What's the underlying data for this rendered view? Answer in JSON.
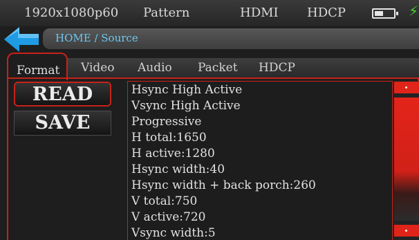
{
  "status_bar": {
    "resolution": "1920x1080p60",
    "mode": "Pattern",
    "interface": "HDMI",
    "protection": "HDCP",
    "battery_icon": "battery-icon",
    "charging_icon": "bolt-icon"
  },
  "breadcrumb": "HOME / Source",
  "tabs": [
    {
      "label": "Format",
      "active": true
    },
    {
      "label": "Video",
      "active": false
    },
    {
      "label": "Audio",
      "active": false
    },
    {
      "label": "Packet",
      "active": false
    },
    {
      "label": "HDCP",
      "active": false
    }
  ],
  "actions": {
    "read_label": "READ",
    "save_label": "SAVE"
  },
  "format_info": [
    "Hsync High Active",
    "Vsync High Active",
    "Progressive",
    "H total:1650",
    "H active:1280",
    "Hsync width:40",
    "Hsync width + back porch:260",
    "V total:750",
    "V active:720",
    "Vsync width:5"
  ],
  "colors": {
    "accent_red": "#c8221a",
    "breadcrumb_blue": "#6ec7f2",
    "back_arrow_blue": "#1e9be3",
    "charging_green": "#4ad12c"
  }
}
